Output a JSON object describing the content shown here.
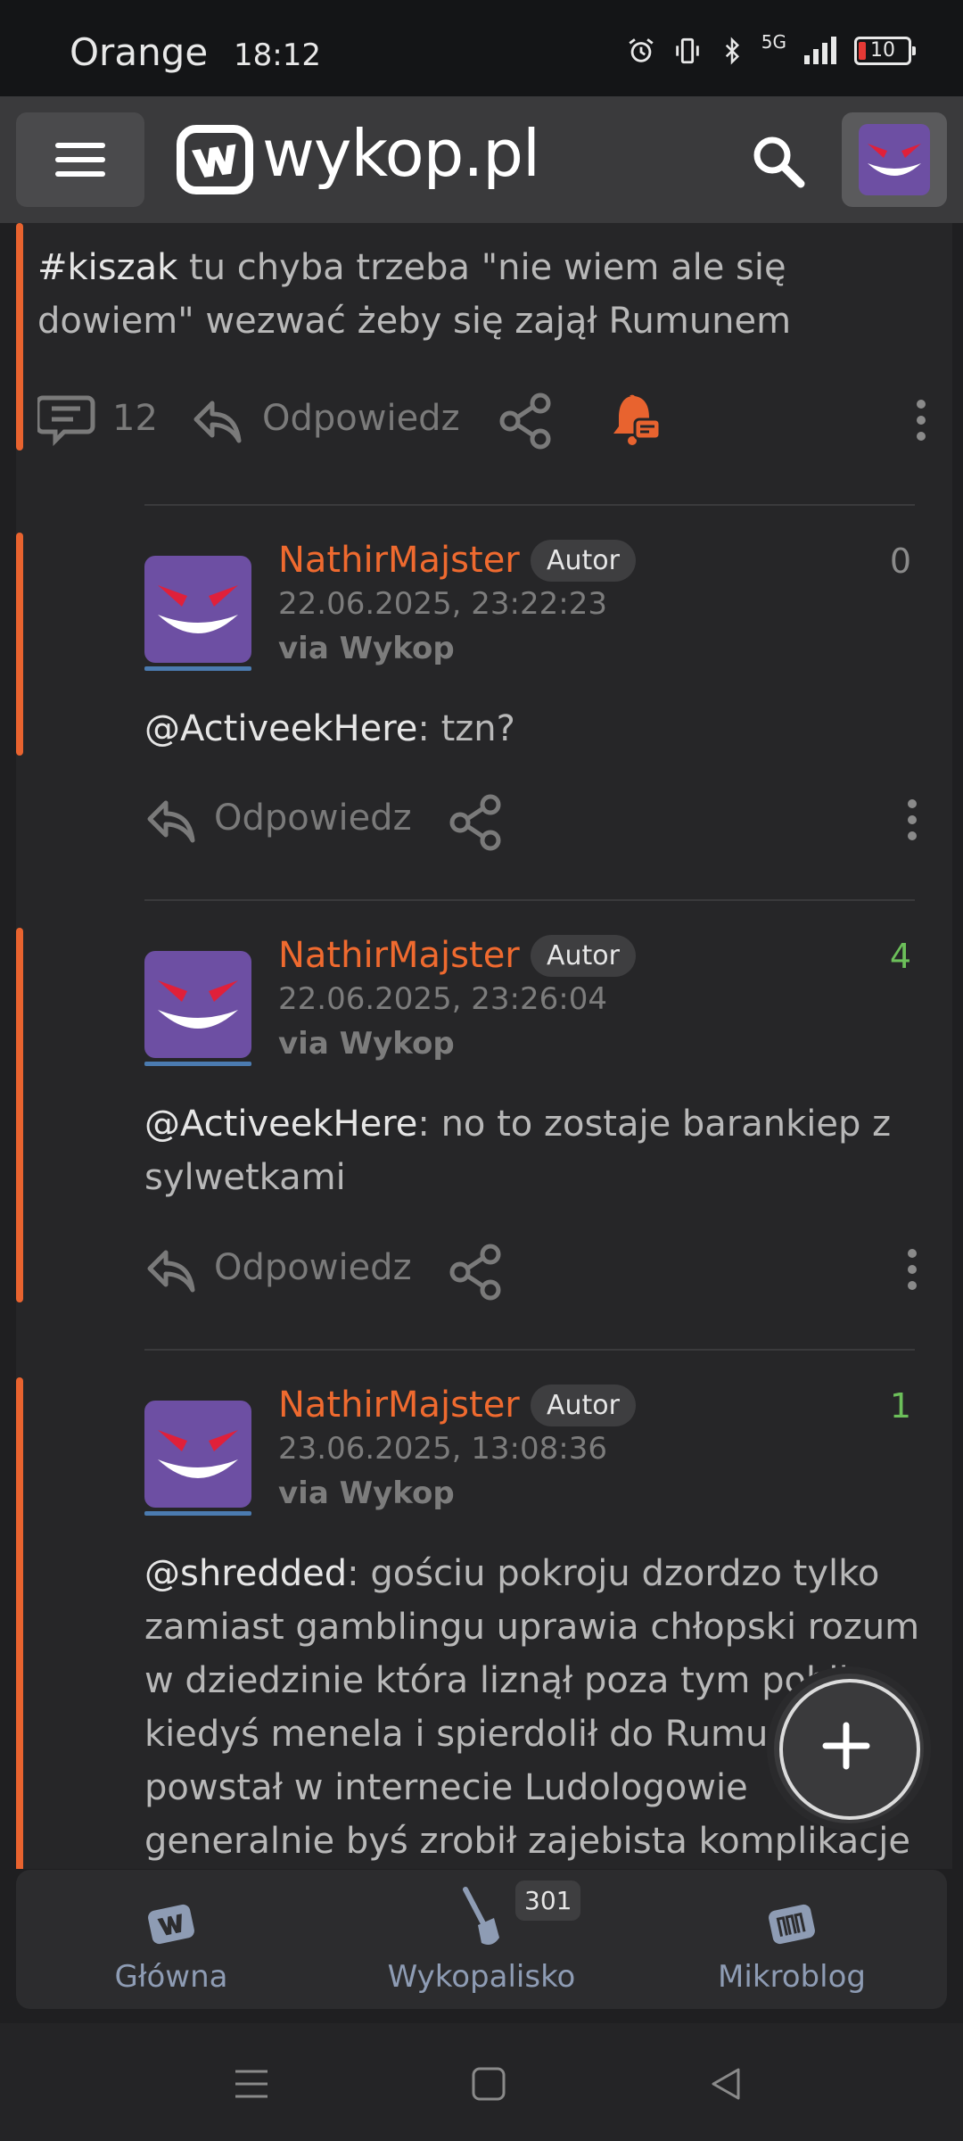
{
  "status_bar": {
    "carrier": "Orange",
    "time": "18:12",
    "signal_label": "5G",
    "battery": "10",
    "icons": [
      "alarm-icon",
      "vibrate-icon",
      "bluetooth-icon",
      "signal-icon",
      "battery-icon"
    ]
  },
  "header": {
    "logo_text": "wykop.pl",
    "menu_icon": "hamburger-icon",
    "search_icon": "search-icon"
  },
  "post": {
    "tag": "#kiszak",
    "text": " tu chyba trzeba \"nie wiem ale się dowiem\" wezwać żeby się zajął Rumunem",
    "comment_count": "12",
    "reply_label": "Odpowiedz",
    "accent_color": "#e8632f"
  },
  "comments": [
    {
      "author": "NathirMajster",
      "badge": "Autor",
      "date": "22.06.2025, 23:22:23",
      "via": "via Wykop",
      "score": "0",
      "mention": "@ActiveekHere",
      "text": ": tzn?",
      "reply_label": "Odpowiedz"
    },
    {
      "author": "NathirMajster",
      "badge": "Autor",
      "date": "22.06.2025, 23:26:04",
      "via": "via Wykop",
      "score": "4",
      "mention": "@ActiveekHere",
      "text": ": no to zostaje barankiep z sylwetkami",
      "reply_label": "Odpowiedz"
    },
    {
      "author": "NathirMajster",
      "badge": "Autor",
      "date": "23.06.2025, 13:08:36",
      "via": "via Wykop",
      "score": "1",
      "mention": "@shredded",
      "text": ": gościu pokroju dzordzo tylko zamiast gamblingu uprawia chłopski rozum w dziedzinie która liznął poza tym pobił kiedyś menela i spierdolił do Rumunii kult powstał w internecie Ludologowie generalnie byś zrobił zajebista komplikacje"
    }
  ],
  "bottom_nav": {
    "items": [
      {
        "label": "Główna",
        "icon": "wykop-home-icon"
      },
      {
        "label": "Wykopalisko",
        "icon": "shovel-icon",
        "badge": "301"
      },
      {
        "label": "Mikroblog",
        "icon": "mikroblog-icon"
      }
    ]
  },
  "colors": {
    "accent": "#e8632f",
    "score_positive": "#6cbf5a",
    "nav_label": "#8e9cb4"
  }
}
